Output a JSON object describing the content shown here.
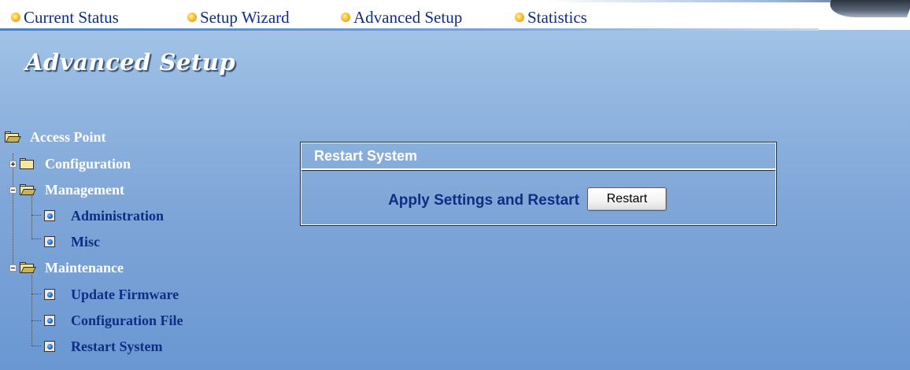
{
  "nav": {
    "items": [
      {
        "label": "Current Status"
      },
      {
        "label": "Setup Wizard"
      },
      {
        "label": "Advanced Setup"
      },
      {
        "label": "Statistics"
      }
    ]
  },
  "page": {
    "title": "Advanced Setup"
  },
  "tree": {
    "root": "Access Point",
    "configuration": "Configuration",
    "management": "Management",
    "administration": "Administration",
    "misc": "Misc",
    "maintenance": "Maintenance",
    "update_firmware": "Update Firmware",
    "configuration_file": "Configuration File",
    "restart_system": "Restart System"
  },
  "panel": {
    "title": "Restart System",
    "apply_label": "Apply Settings and Restart",
    "restart_button": "Restart"
  },
  "colors": {
    "nav_text": "#0d2e82",
    "link_text": "#0d2e82",
    "background_top": "#a9c9ea",
    "background_bottom": "#6a97d2"
  },
  "icons": {
    "nav_bullet": "yellow-bullet-icon",
    "folder_open": "folder-open-icon",
    "folder_closed": "folder-closed-icon",
    "page": "page-icon",
    "expand": "plus-expander-icon",
    "collapse": "minus-expander-icon"
  }
}
